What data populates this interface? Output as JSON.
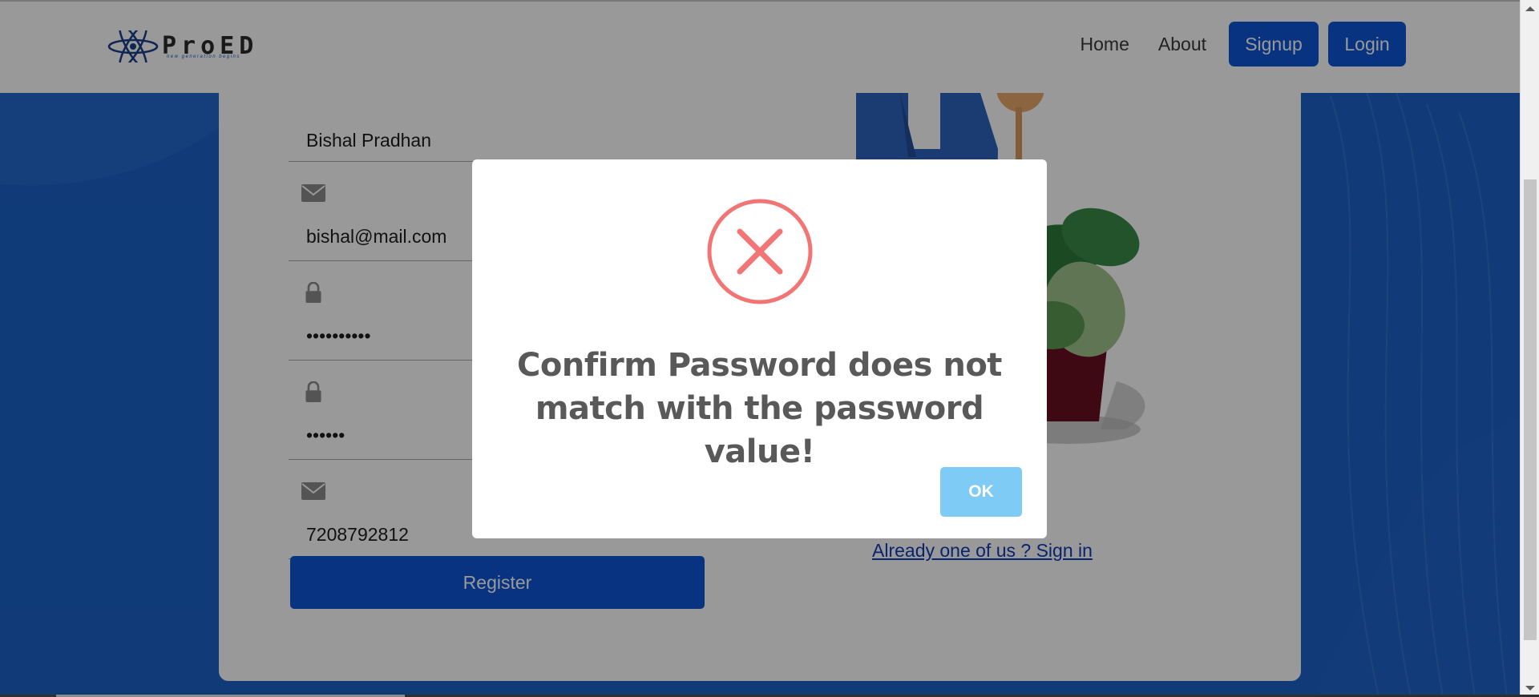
{
  "navbar": {
    "logo_text": "ProED",
    "logo_tagline": "new generation begins",
    "links": {
      "home": "Home",
      "about": "About"
    },
    "signup_label": "Signup",
    "login_label": "Login"
  },
  "form": {
    "name_value": "Bishal Pradhan",
    "email_value": "bishal@mail.com",
    "password_value": "••••••••••",
    "confirm_password_value": "••••••",
    "phone_value": "7208792812",
    "register_label": "Register",
    "signin_link": "Already one of us ? Sign in"
  },
  "dialog": {
    "icon": "error-x-icon",
    "message": "Confirm Password does not match with the password value!",
    "ok_label": "OK"
  },
  "colors": {
    "brand_blue": "#0d56d6",
    "background_blue": "#1b63c9",
    "error_red": "#f27474",
    "ok_button": "#7ecbf5"
  }
}
